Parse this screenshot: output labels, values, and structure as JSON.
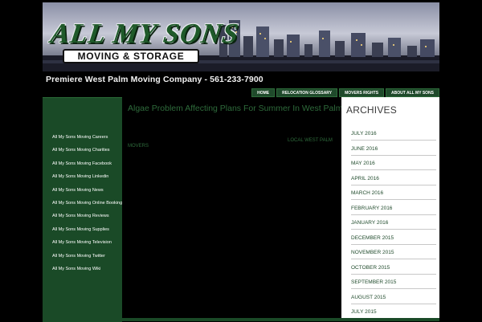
{
  "header": {
    "logo_line1": "ALL MY SONS",
    "logo_line2": "MOVING & STORAGE",
    "tagline": "Premiere West Palm Moving Company - 561-233-7900"
  },
  "nav": {
    "items": [
      {
        "label": "HOME"
      },
      {
        "label": "RELOCATION GLOSSARY"
      },
      {
        "label": "MOVERS RIGHTS"
      },
      {
        "label": "ABOUT ALL MY SONS"
      }
    ]
  },
  "sidebar": {
    "items": [
      {
        "label": "All My Sons Moving Careers"
      },
      {
        "label": "All My Sons Moving Charities"
      },
      {
        "label": "All My Sons Moving Facebook"
      },
      {
        "label": "All My Sons Moving Linkedin"
      },
      {
        "label": "All My Sons Moving News"
      },
      {
        "label": "All My Sons Moving Online Booking"
      },
      {
        "label": "All My Sons Moving Reviews"
      },
      {
        "label": "All My Sons Moving Supplies"
      },
      {
        "label": "All My Sons Moving Television"
      },
      {
        "label": "All My Sons Moving Twitter"
      },
      {
        "label": "All My Sons Moving Wiki"
      }
    ]
  },
  "post": {
    "title": "Algae Problem Affecting Plans For Summer In West Palm",
    "meta": "MOVERS",
    "tag": "LOCAL WEST PALM"
  },
  "archives": {
    "title": "ARCHIVES",
    "items": [
      {
        "label": "JULY 2016"
      },
      {
        "label": "JUNE 2016"
      },
      {
        "label": "MAY 2016"
      },
      {
        "label": "APRIL 2016"
      },
      {
        "label": "MARCH 2016"
      },
      {
        "label": "FEBRUARY 2016"
      },
      {
        "label": "JANUARY 2016"
      },
      {
        "label": "DECEMBER 2015"
      },
      {
        "label": "NOVEMBER 2015"
      },
      {
        "label": "OCTOBER 2015"
      },
      {
        "label": "SEPTEMBER 2015"
      },
      {
        "label": "AUGUST 2015"
      },
      {
        "label": "JULY 2015"
      }
    ]
  },
  "colors": {
    "accent": "#1f4a2b",
    "sidebar_bg": "#1a4a27",
    "title_green": "#2e6b3b",
    "page_bg": "#000000",
    "panel_bg": "#ffffff"
  }
}
